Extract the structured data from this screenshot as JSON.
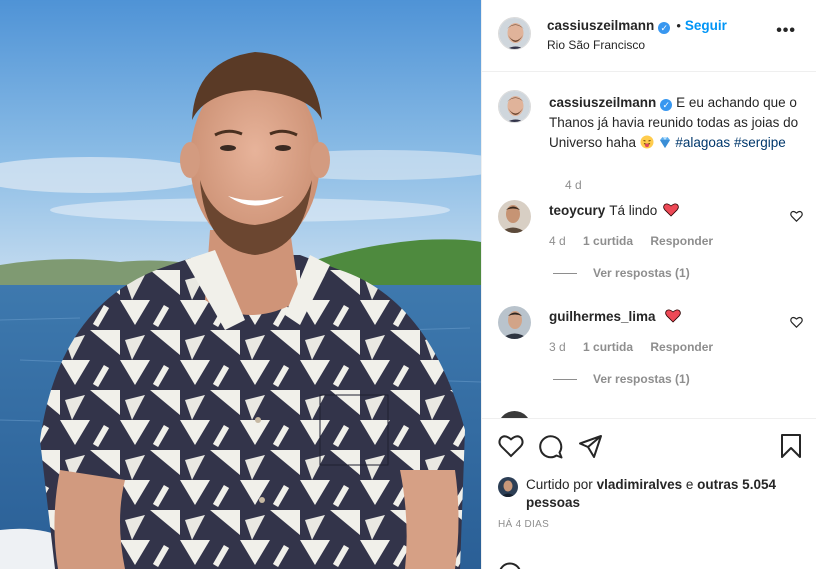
{
  "post": {
    "author": "cassiuszeilmann",
    "location": "Rio São Francisco",
    "follow_label": "Seguir",
    "separator": "•",
    "more_label": "•••"
  },
  "caption": {
    "username": "cassiuszeilmann",
    "text": "E eu achando que o Thanos já havia reunido todas as joias do Universo haha",
    "hashtags": [
      "#alagoas",
      "#sergipe"
    ],
    "time": "4 d"
  },
  "comments": [
    {
      "username": "teoycury",
      "text": "Tá lindo",
      "time": "4 d",
      "likes": "1 curtida",
      "reply_label": "Responder",
      "view_replies": "Ver respostas (1)"
    },
    {
      "username": "guilhermes_lima",
      "text": "",
      "time": "3 d",
      "likes": "1 curtida",
      "reply_label": "Responder",
      "view_replies": "Ver respostas (1)"
    }
  ],
  "likes": {
    "prefix": "Curtido por",
    "user": "vladimiralves",
    "connector": "e",
    "others": "outras 5.054 pessoas"
  },
  "timestamp": "HÁ 4 DIAS",
  "icons": {
    "like": "heart-outline-icon",
    "comment": "speech-bubble-icon",
    "share": "paper-plane-icon",
    "save": "bookmark-icon",
    "verified": "verified-badge-icon"
  },
  "colors": {
    "accent": "#0095f6",
    "verified": "#3897f0",
    "hashtag": "#00376b",
    "heart": "#ed4956",
    "muted": "#8e8e8e"
  }
}
